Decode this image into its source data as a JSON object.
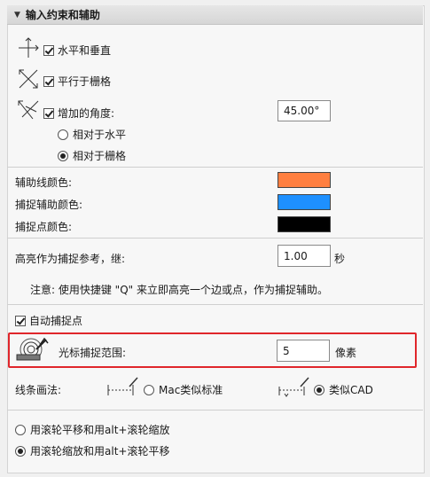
{
  "header": {
    "title": "输入约束和辅助"
  },
  "constraints": {
    "horizontal_vertical": {
      "label": "水平和垂直",
      "checked": true
    },
    "parallel_grid": {
      "label": "平行于栅格",
      "checked": true
    },
    "angle_increment": {
      "label": "增加的角度:",
      "checked": true,
      "value": "45.00°"
    },
    "relative_horizontal": {
      "label": "相对于水平",
      "selected": false
    },
    "relative_grid": {
      "label": "相对于栅格",
      "selected": true
    }
  },
  "colors": {
    "guide_line": {
      "label": "辅助线颜色:",
      "color": "#ff7f40"
    },
    "snap_guide": {
      "label": "捕捉辅助颜色:",
      "color": "#1e90ff"
    },
    "snap_point": {
      "label": "捕捉点颜色:",
      "color": "#000000"
    }
  },
  "highlight": {
    "label": "高亮作为捕捉参考，继:",
    "value": "1.00",
    "unit": "秒"
  },
  "note": "注意: 使用快捷键 \"Q\" 来立即高亮一个边或点，作为捕捉辅助。",
  "auto_snap": {
    "label": "自动捕捉点",
    "checked": true
  },
  "cursor_snap": {
    "label": "光标捕捉范围:",
    "value": "5",
    "unit": "像素"
  },
  "line_method": {
    "label": "线条画法:",
    "mac_standard": {
      "label": "Mac类似标准",
      "selected": false
    },
    "cad_like": {
      "label": "类似CAD",
      "selected": true
    }
  },
  "wheel": {
    "option1": {
      "label": "用滚轮平移和用alt+滚轮缩放",
      "selected": false
    },
    "option2": {
      "label": "用滚轮缩放和用alt+滚轮平移",
      "selected": true
    }
  }
}
